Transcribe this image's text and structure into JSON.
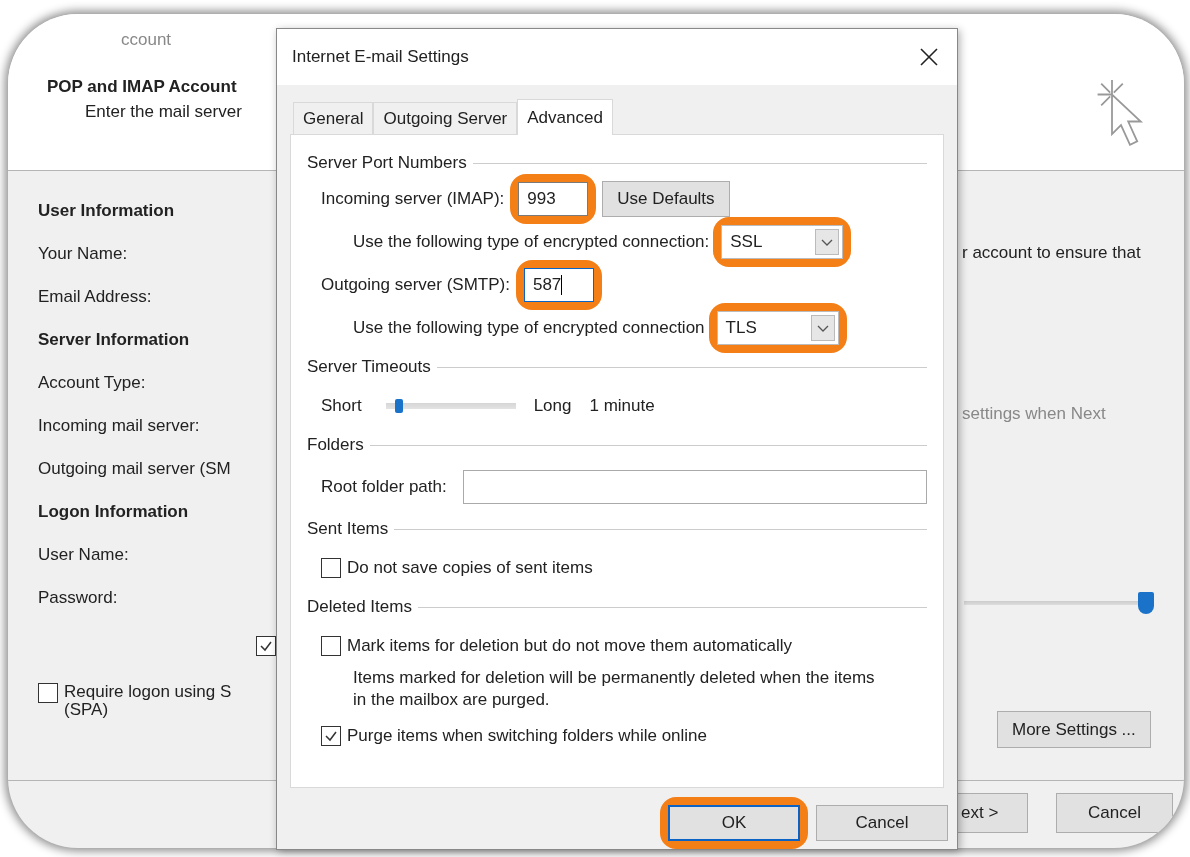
{
  "background_window": {
    "title": "ccount",
    "heading": "POP and IMAP Account",
    "subheading": "Enter the mail server",
    "sections": [
      {
        "heading": "User Information",
        "labels": [
          "Your Name:",
          "Email Address:"
        ]
      },
      {
        "heading": "Server Information",
        "labels": [
          "Account Type:",
          "Incoming mail server:",
          "Outgoing mail server (SM"
        ]
      },
      {
        "heading": "Logon Information",
        "labels": [
          "User Name:",
          "Password:"
        ]
      }
    ],
    "remember_password": {
      "checked": true
    },
    "spa": {
      "label": "Require logon using S",
      "label_line2": "(SPA)",
      "checked": false
    },
    "right_texts": [
      {
        "text": "r account to ensure that",
        "disabled": false
      },
      {
        "text": "settings when Next",
        "disabled": true
      }
    ],
    "slider": {
      "level": 1
    },
    "more_settings": "More Settings ...",
    "buttons": [
      "ext >",
      "Cancel"
    ]
  },
  "dialog": {
    "title": "Internet E-mail Settings",
    "tabs": [
      {
        "label": "General",
        "selected": false
      },
      {
        "label": "Outgoing Server",
        "selected": false
      },
      {
        "label": "Advanced",
        "selected": true
      }
    ],
    "ports": {
      "heading": "Server Port Numbers",
      "incoming": {
        "label": "Incoming server (IMAP):",
        "value": "993",
        "highlighted": true
      },
      "use_defaults": "Use Defaults",
      "incoming_encryption": {
        "label": "Use the following type of encrypted connection:",
        "value": "SSL",
        "highlighted": true
      },
      "outgoing": {
        "label": "Outgoing server (SMTP):",
        "value": "587",
        "highlighted": true
      },
      "outgoing_encryption": {
        "label": "Use the following type of encrypted connection",
        "value": "TLS",
        "highlighted": true
      }
    },
    "timeouts": {
      "heading": "Server Timeouts",
      "short": "Short",
      "long": "Long",
      "level": 0.08,
      "reading": "1 minute"
    },
    "folders": {
      "heading": "Folders",
      "label": "Root folder path:"
    },
    "sent_items": {
      "heading": "Sent Items",
      "checkboxes": [
        {
          "label": "Do not save copies of sent items",
          "checked": false
        }
      ]
    },
    "deleted_items": {
      "heading": "Deleted Items",
      "mark": {
        "label": "Mark items for deletion but do not move them automatically",
        "checked": false
      },
      "note": "Items marked for deletion will be permanently deleted when the items in the mailbox are purged.",
      "purge": {
        "label": "Purge items when switching folders while online",
        "checked": true
      }
    },
    "buttons": [
      {
        "label": "OK",
        "highlighted": true
      },
      {
        "label": "Cancel",
        "highlighted": false
      }
    ]
  }
}
